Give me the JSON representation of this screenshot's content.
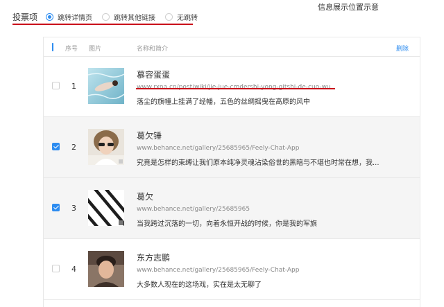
{
  "annotation_title": "信息展示位置示意",
  "vote": {
    "label": "投票项",
    "options": [
      {
        "label": "跳转详情页",
        "checked": true
      },
      {
        "label": "跳转其他链接",
        "checked": false
      },
      {
        "label": "无跳转",
        "checked": false
      }
    ]
  },
  "table": {
    "headers": {
      "index": "序号",
      "image": "图片",
      "name_intro": "名称和简介",
      "delete": "删除"
    },
    "rows": [
      {
        "index": "1",
        "checked": false,
        "title": "慕容蛋蛋",
        "url": "www.rxna.cn/post/wiki/jie-jue-cmdershi-yong-gitshi-de-cuo-wu",
        "desc": "落尘的旗幢上挂满了经幡，五色的丝绸摇曳在高原的风中",
        "thumb": "water"
      },
      {
        "index": "2",
        "checked": true,
        "title": "葛欠锤",
        "url": "www.behance.net/gallery/25685965/Feely-Chat-App",
        "desc": "究竟是怎样的束缚让我们原本纯净灵魂沾染俗世的黑暗与不堪也时常在想，我...",
        "thumb": "girl"
      },
      {
        "index": "3",
        "checked": true,
        "title": "葛欠",
        "url": "www.behance.net/gallery/25685965",
        "desc": "当我跨过沉落的一切，向着永恒开战的时候，你是我的军旗",
        "thumb": "stripes"
      },
      {
        "index": "4",
        "checked": false,
        "title": "东方志鹏",
        "url": "www.behance.net/gallery/25685965/Feely-Chat-App",
        "desc": "大多数人现在的这场戏，实在是太无聊了",
        "thumb": "boy"
      }
    ]
  },
  "colors": {
    "accent": "#2d8cf0",
    "annotation_red": "#c9101a"
  }
}
